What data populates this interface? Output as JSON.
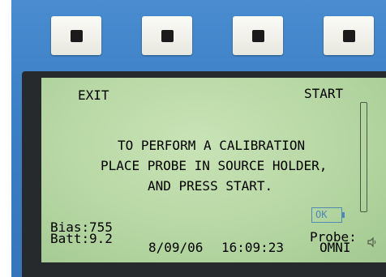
{
  "softkeys": [
    {
      "id": "softkey-1"
    },
    {
      "id": "softkey-2"
    },
    {
      "id": "softkey-3"
    },
    {
      "id": "softkey-4"
    }
  ],
  "screen": {
    "exit_label": "EXIT",
    "start_label": "START",
    "message": [
      "TO PERFORM A CALIBRATION",
      "PLACE PROBE IN SOURCE HOLDER,",
      "AND PRESS START."
    ],
    "ok_label": "OK",
    "status": {
      "bias_label": "Bias:",
      "bias_value": "755",
      "batt_label": "Batt:",
      "batt_value": "9.2",
      "date": "8/09/06",
      "time": "16:09:23",
      "probe_label": "Probe:",
      "probe_value": "OMNI"
    }
  },
  "colors": {
    "panel_blue": "#3b7fc6",
    "lcd_green": "#b6d7a3",
    "lcd_text": "#3f4c3a",
    "ok_blue": "#4f89b4"
  }
}
